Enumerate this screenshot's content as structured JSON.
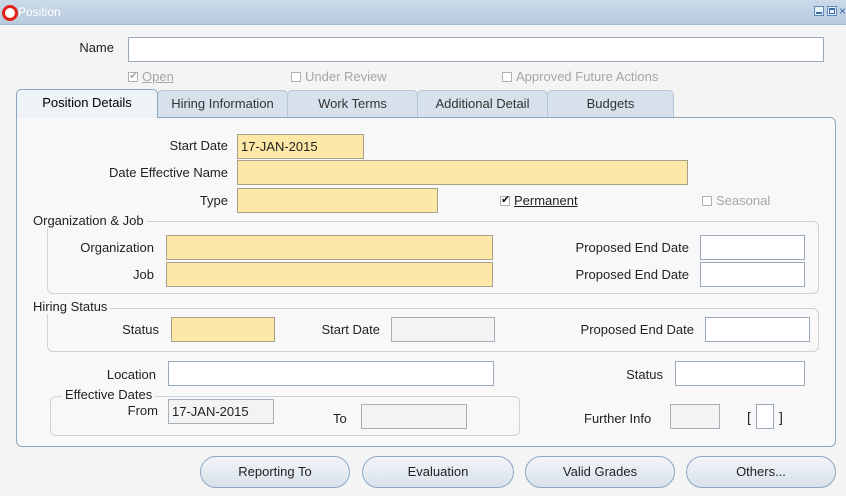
{
  "window": {
    "title": "Position"
  },
  "header": {
    "name_label": "Name",
    "name_value": "",
    "open": {
      "label": "Open",
      "checked": true
    },
    "under_review": {
      "label": "Under Review",
      "checked": false
    },
    "approved_future_actions": {
      "label": "Approved Future Actions",
      "checked": false
    }
  },
  "tabs": [
    {
      "label": "Position Details",
      "active": true
    },
    {
      "label": "Hiring Information",
      "active": false
    },
    {
      "label": "Work Terms",
      "active": false
    },
    {
      "label": "Additional Detail",
      "active": false
    },
    {
      "label": "Budgets",
      "active": false
    }
  ],
  "details": {
    "start_date_label": "Start Date",
    "start_date_value": "17-JAN-2015",
    "date_effective_name_label": "Date Effective Name",
    "date_effective_name_value": "",
    "type_label": "Type",
    "type_value": "",
    "permanent": {
      "label": "Permanent",
      "checked": true
    },
    "seasonal": {
      "label": "Seasonal",
      "checked": false
    }
  },
  "org_job": {
    "legend": "Organization & Job",
    "organization_label": "Organization",
    "organization_value": "",
    "job_label": "Job",
    "job_value": "",
    "proposed_end_date_label_1": "Proposed End Date",
    "proposed_end_date_value_1": "",
    "proposed_end_date_label_2": "Proposed End Date",
    "proposed_end_date_value_2": ""
  },
  "hiring_status": {
    "legend": "Hiring Status",
    "status_label": "Status",
    "status_value": "",
    "start_date_label": "Start Date",
    "start_date_value": "",
    "proposed_end_date_label": "Proposed End Date",
    "proposed_end_date_value": ""
  },
  "location": {
    "location_label": "Location",
    "location_value": "",
    "status_label": "Status",
    "status_value": ""
  },
  "effective_dates": {
    "legend_line1": "Effective Dates",
    "from_label": "From",
    "from_value": "17-JAN-2015",
    "to_label": "To",
    "to_value": "",
    "further_info_label": "Further Info",
    "further_info_value": "",
    "dff_open": "[",
    "dff_close": "]"
  },
  "buttons": {
    "reporting_to": "Reporting To",
    "evaluation": "Evaluation",
    "valid_grades": "Valid Grades",
    "others": "Others..."
  },
  "colors": {
    "required_field": "#fde8a7",
    "titlebar": "#b7cadd",
    "oracle_red": "#e2231a",
    "tab_active": "#eef3f8",
    "tab_inactive": "#d7e1ec"
  },
  "icons": [
    "oracle-logo-icon",
    "minimize-icon",
    "maximize-icon",
    "close-icon",
    "checkbox-icon"
  ]
}
